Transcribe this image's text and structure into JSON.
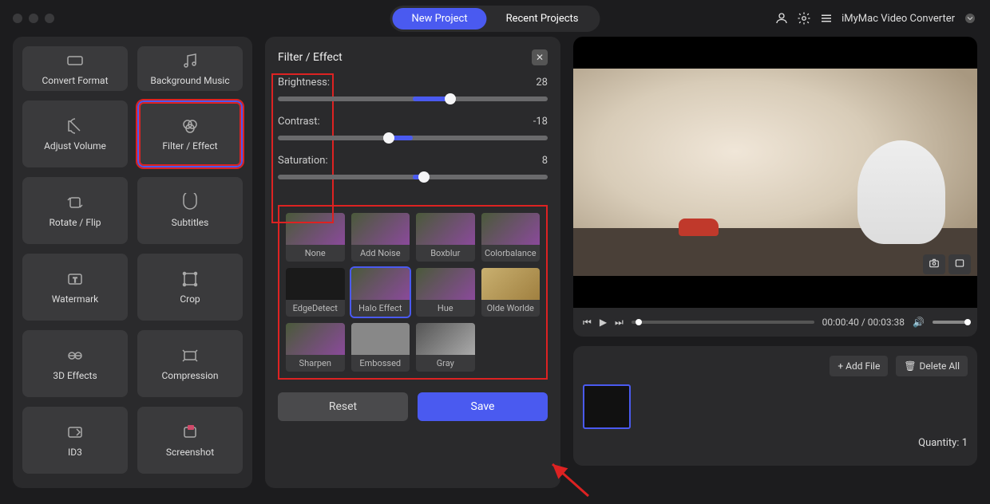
{
  "app_name": "iMyMac Video Converter",
  "top_tabs": {
    "new_project": "New Project",
    "recent_projects": "Recent Projects"
  },
  "tools": {
    "convert_format": "Convert Format",
    "background_music": "Background Music",
    "adjust_volume": "Adjust Volume",
    "filter_effect": "Filter / Effect",
    "rotate_flip": "Rotate / Flip",
    "subtitles": "Subtitles",
    "watermark": "Watermark",
    "crop": "Crop",
    "three_d_effects": "3D Effects",
    "compression": "Compression",
    "id3": "ID3",
    "screenshot": "Screenshot"
  },
  "filter_panel": {
    "title": "Filter / Effect",
    "sliders": {
      "brightness": {
        "label": "Brightness:",
        "value": "28",
        "pct": 64,
        "fill_start": 50,
        "fill_end": 64
      },
      "contrast": {
        "label": "Contrast:",
        "value": "-18",
        "pct": 41,
        "fill_start": 41,
        "fill_end": 50
      },
      "saturation": {
        "label": "Saturation:",
        "value": "8",
        "pct": 54,
        "fill_start": 50,
        "fill_end": 54
      }
    },
    "filters": [
      {
        "name": "None",
        "class": ""
      },
      {
        "name": "Add Noise",
        "class": ""
      },
      {
        "name": "Boxblur",
        "class": ""
      },
      {
        "name": "Colorbalance",
        "class": ""
      },
      {
        "name": "EdgeDetect",
        "class": "edge"
      },
      {
        "name": "Halo Effect",
        "class": "",
        "selected": true
      },
      {
        "name": "Hue",
        "class": ""
      },
      {
        "name": "Olde Worlde",
        "class": "olde"
      },
      {
        "name": "Sharpen",
        "class": ""
      },
      {
        "name": "Embossed",
        "class": "emboss"
      },
      {
        "name": "Gray",
        "class": "gray"
      }
    ],
    "reset": "Reset",
    "save": "Save"
  },
  "preview": {
    "time_current": "00:00:40",
    "time_total": "00:03:38"
  },
  "bottom": {
    "add_file": "+ Add File",
    "delete_all": "Delete All",
    "quantity_label": "Quantity:",
    "quantity_value": "1"
  }
}
